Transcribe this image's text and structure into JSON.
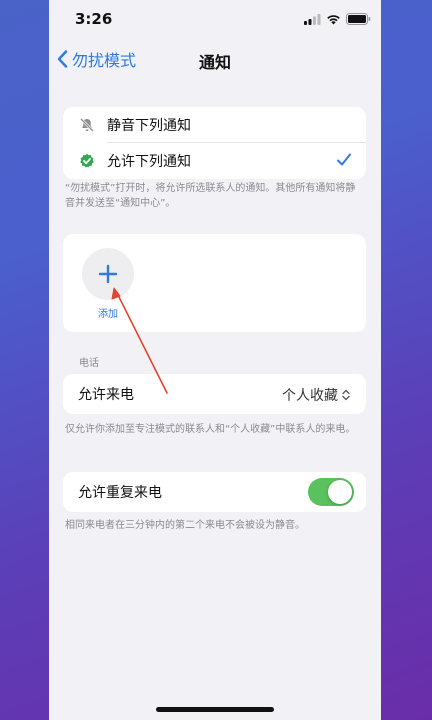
{
  "status": {
    "time": "3:26"
  },
  "nav": {
    "back_label": "勿扰模式",
    "title": "通知"
  },
  "notify_options": [
    {
      "label": "静音下列通知",
      "icon": "bell-slash-icon",
      "selected": false
    },
    {
      "label": "允许下列通知",
      "icon": "green-check-badge-icon",
      "selected": true
    }
  ],
  "notify_footnote": "“勿扰模式”打开时，将允许所选联系人的通知。其他所有通知将静音并发送至“通知中心”。",
  "add": {
    "label": "添加"
  },
  "calls": {
    "section_label": "电话",
    "allow_calls_label": "允许来电",
    "allow_calls_value": "个人收藏",
    "allow_calls_footnote": "仅允许你添加至专注模式的联系人和“个人收藏”中联系人的来电。",
    "repeat_calls_label": "允许重复来电",
    "repeat_calls_enabled": true,
    "repeat_calls_footnote": "相同来电者在三分钟内的第二个来电不会被设为静音。"
  },
  "colors": {
    "accent": "#2f7ae0",
    "toggle_on": "#5ac15e",
    "annotation_arrow": "#e0452f"
  }
}
